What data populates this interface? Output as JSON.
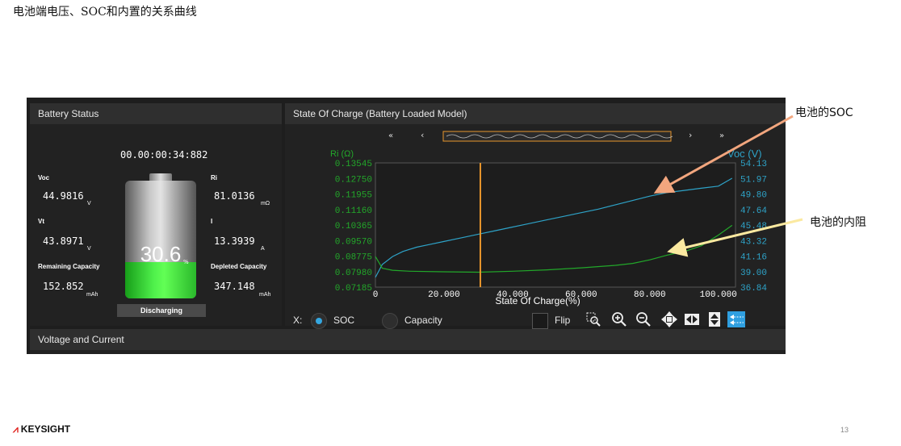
{
  "slide": {
    "title": "电池端电压、SOC和内置的关系曲线",
    "page_number": "13",
    "logo_text": "KEYSIGHT"
  },
  "callouts": {
    "soc": "电池的SOC",
    "ri": "电池的内阻"
  },
  "battery_status": {
    "title": "Battery Status",
    "timer": "00.00:00:34:882",
    "voc": {
      "label": "Voc",
      "value": "44.9816",
      "unit": "V"
    },
    "ri": {
      "label": "Ri",
      "value": "81.0136",
      "unit": "mΩ"
    },
    "vt": {
      "label": "Vt",
      "value": "43.8971",
      "unit": "V"
    },
    "i": {
      "label": "I",
      "value": "13.3939",
      "unit": "A"
    },
    "remaining": {
      "label": "Remaining Capacity",
      "value": "152.852",
      "unit": "mAh"
    },
    "depleted": {
      "label": "Depleted Capacity",
      "value": "347.148",
      "unit": "mAh"
    },
    "percent": "30.6",
    "percent_sign": "%",
    "fill_fraction": 0.306,
    "state": "Discharging"
  },
  "soc_panel": {
    "title": "State Of Charge (Battery Loaded Model)",
    "x_label": "X:",
    "radio_soc": "SOC",
    "radio_capacity": "Capacity",
    "flip_label": "Flip",
    "scroll_left2": "«",
    "scroll_left": "‹",
    "scroll_right": "›",
    "scroll_right2": "»"
  },
  "voltage_current": {
    "title": "Voltage and Current"
  },
  "chart_data": {
    "type": "line",
    "xlabel": "State Of Charge(%)",
    "ylabel_left": "Ri (Ω)",
    "ylabel_right": "Voc (V)",
    "x_ticks": [
      "0",
      "20.000",
      "40.000",
      "60.000",
      "80.000",
      "100.000"
    ],
    "y_left_ticks": [
      "0.13545",
      "0.12750",
      "0.11955",
      "0.11160",
      "0.10365",
      "0.09570",
      "0.08775",
      "0.07980",
      "0.07185"
    ],
    "y_right_ticks": [
      "54.13",
      "51.97",
      "49.80",
      "47.64",
      "45.48",
      "43.32",
      "41.16",
      "39.00",
      "36.84"
    ],
    "xlim": [
      0,
      105
    ],
    "ylim_left": [
      0.07185,
      0.13545
    ],
    "ylim_right": [
      36.84,
      54.13
    ],
    "marker_x": 30.6,
    "colors": {
      "voc": "#2ea3c8",
      "ri": "#22a82a",
      "marker": "#e8952c"
    },
    "series": [
      {
        "name": "Voc (V)",
        "axis": "right",
        "x": [
          0,
          2,
          5,
          8,
          12,
          16,
          20,
          25,
          30,
          35,
          40,
          45,
          50,
          55,
          60,
          65,
          70,
          75,
          80,
          85,
          90,
          95,
          100,
          104
        ],
        "y": [
          38.2,
          40.0,
          41.1,
          41.8,
          42.4,
          42.8,
          43.2,
          43.7,
          44.2,
          44.7,
          45.2,
          45.7,
          46.2,
          46.7,
          47.2,
          47.7,
          48.3,
          48.9,
          49.5,
          50.0,
          50.3,
          50.6,
          50.9,
          52.0
        ]
      },
      {
        "name": "Ri (Ω)",
        "axis": "left",
        "x": [
          0,
          2,
          5,
          10,
          20,
          30,
          40,
          50,
          60,
          70,
          75,
          80,
          85,
          87,
          90,
          95,
          100,
          104
        ],
        "y": [
          0.0875,
          0.0815,
          0.0805,
          0.08,
          0.0797,
          0.0795,
          0.08,
          0.0807,
          0.0817,
          0.083,
          0.084,
          0.0858,
          0.0882,
          0.089,
          0.09,
          0.093,
          0.0985,
          0.1035
        ]
      }
    ]
  }
}
